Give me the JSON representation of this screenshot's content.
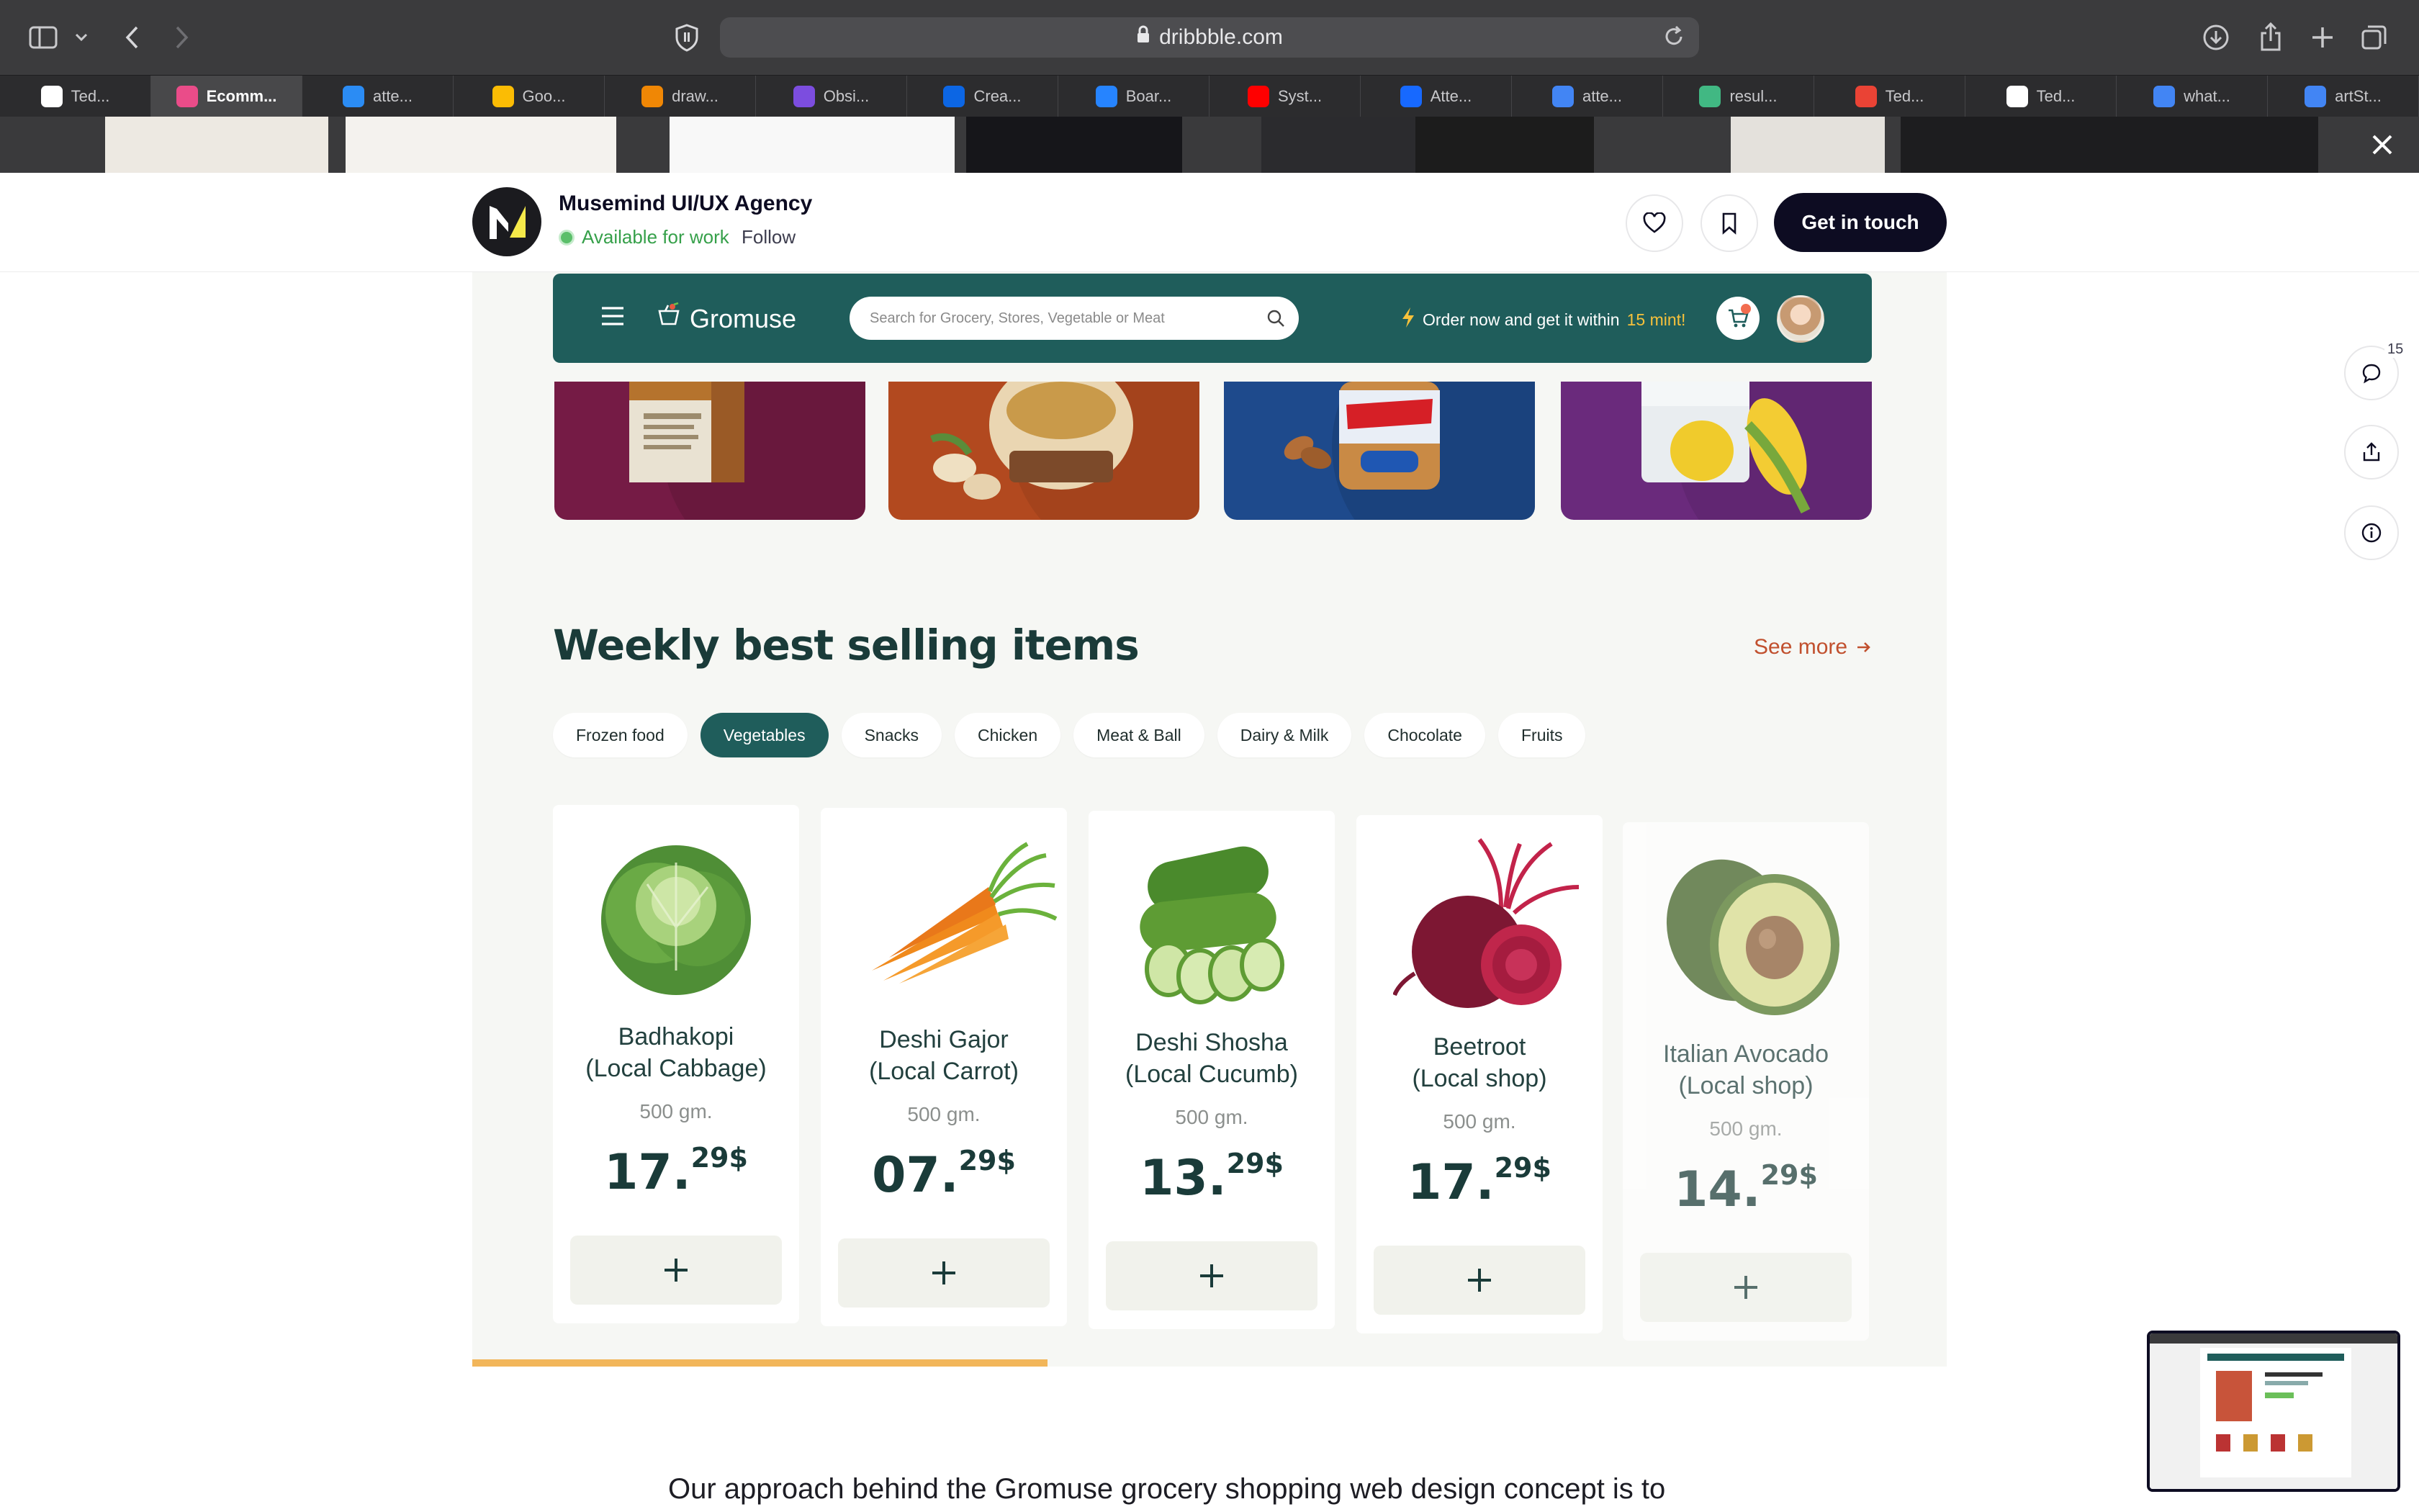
{
  "browser": {
    "url": "dribbble.com",
    "tabs": [
      {
        "label": "Ted...",
        "favicon": "github-icon",
        "color": "#ffffff"
      },
      {
        "label": "Ecomm...",
        "favicon": "dribbble-icon",
        "color": "#ea4c89",
        "active": true
      },
      {
        "label": "atte...",
        "favicon": "c-icon",
        "color": "#2b8cf4"
      },
      {
        "label": "Goo...",
        "favicon": "drive-icon",
        "color": "#fbbc04"
      },
      {
        "label": "draw...",
        "favicon": "draw-icon",
        "color": "#f08705"
      },
      {
        "label": "Obsi...",
        "favicon": "obsidian-icon",
        "color": "#7c4ddf"
      },
      {
        "label": "Crea...",
        "favicon": "trello-icon",
        "color": "#0c66e4"
      },
      {
        "label": "Boar...",
        "favicon": "jira-icon",
        "color": "#2684ff"
      },
      {
        "label": "Syst...",
        "favicon": "youtube-icon",
        "color": "#ff0000"
      },
      {
        "label": "Atte...",
        "favicon": "behance-icon",
        "color": "#1769ff"
      },
      {
        "label": "atte...",
        "favicon": "google-icon",
        "color": "#4285f4"
      },
      {
        "label": "resul...",
        "favicon": "vue-icon",
        "color": "#41b883"
      },
      {
        "label": "Ted...",
        "favicon": "gmail-icon",
        "color": "#ea4335"
      },
      {
        "label": "Ted...",
        "favicon": "github-icon",
        "color": "#ffffff"
      },
      {
        "label": "what...",
        "favicon": "google-icon",
        "color": "#4285f4"
      },
      {
        "label": "artSt...",
        "favicon": "google-icon",
        "color": "#4285f4"
      }
    ]
  },
  "shot_header": {
    "author": "Musemind UI/UX Agency",
    "availability": "Available for work",
    "follow": "Follow",
    "cta": "Get in touch"
  },
  "app": {
    "brand": "Gromuse",
    "search_placeholder": "Search for Grocery, Stores, Vegetable or Meat",
    "promo_prefix": "Order now and get it within",
    "promo_highlight": "15 mint!",
    "colors": {
      "primary": "#1f5d5b",
      "accent": "#f7c13b",
      "link": "#c1502e"
    },
    "banners": [
      {
        "color": "#751b45",
        "product": "flour"
      },
      {
        "color": "#b2491f",
        "product": "organic-peanut-butter"
      },
      {
        "color": "#1e4a8c",
        "product": "skippy-peanut-butter"
      },
      {
        "color": "#6a2a7c",
        "product": "kernel-corn"
      }
    ]
  },
  "section": {
    "title": "Weekly best selling items",
    "see_more": "See more",
    "chips": [
      {
        "label": "Frozen food"
      },
      {
        "label": "Vegetables",
        "active": true
      },
      {
        "label": "Snacks"
      },
      {
        "label": "Chicken"
      },
      {
        "label": "Meat & Ball"
      },
      {
        "label": "Dairy & Milk"
      },
      {
        "label": "Chocolate"
      },
      {
        "label": "Fruits"
      }
    ],
    "products": [
      {
        "name_line1": "Badhakopi",
        "name_line2": "(Local Cabbage)",
        "weight": "500 gm.",
        "price_whole": "17.",
        "price_fraction": "29$",
        "image": "cabbage"
      },
      {
        "name_line1": "Deshi Gajor",
        "name_line2": "(Local Carrot)",
        "weight": "500 gm.",
        "price_whole": "07.",
        "price_fraction": "29$",
        "image": "carrot"
      },
      {
        "name_line1": "Deshi Shosha",
        "name_line2": "(Local Cucumb)",
        "weight": "500 gm.",
        "price_whole": "13.",
        "price_fraction": "29$",
        "image": "cucumber"
      },
      {
        "name_line1": "Beetroot",
        "name_line2": "(Local shop)",
        "weight": "500 gm.",
        "price_whole": "17.",
        "price_fraction": "29$",
        "image": "beetroot"
      },
      {
        "name_line1": "Italian Avocado",
        "name_line2": "(Local shop)",
        "weight": "500 gm.",
        "price_whole": "14.",
        "price_fraction": "29$",
        "image": "avocado"
      }
    ],
    "scroll_progress": 0.39
  },
  "side": {
    "comment_count": "15"
  },
  "description": "Our approach behind the Gromuse grocery shopping web design concept is to"
}
